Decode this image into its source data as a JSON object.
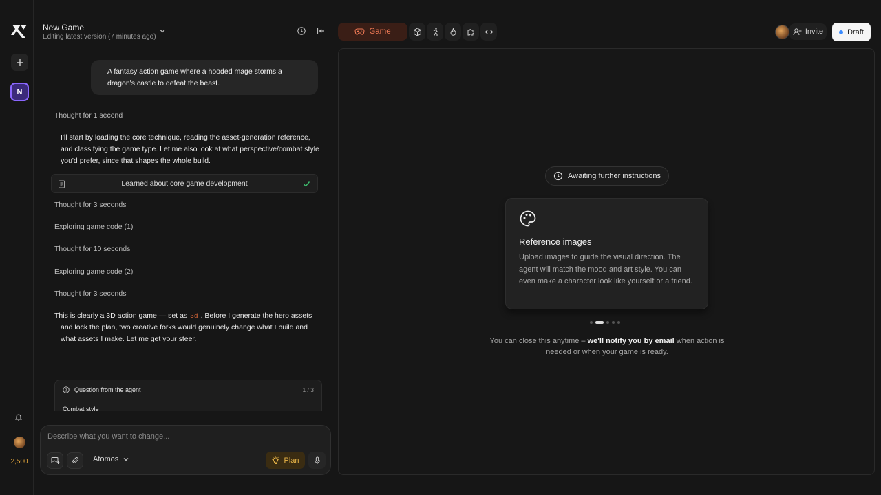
{
  "header": {
    "title": "New Game",
    "subtitle": "Editing latest version (7 minutes ago)"
  },
  "sidebar": {
    "project_initial": "N",
    "credits": "2,500"
  },
  "chat": {
    "user_message": "A fantasy action game where a hooded mage storms a dragon's castle to defeat the beast.",
    "thought_1": "Thought for 1 second",
    "para_1": "I'll start by loading the core technique, reading the asset-generation reference, and classifying the game type. Let me also look at what perspective/combat style you'd prefer, since that shapes the whole build.",
    "learned": "Learned about core game development",
    "thought_2": "Thought for 3 seconds",
    "explore_1": "Exploring game code (1)",
    "thought_3": "Thought for 10 seconds",
    "explore_2": "Exploring game code (2)",
    "thought_4": "Thought for 3 seconds",
    "para_2_pre": "This is clearly a 3D action game — set as",
    "para_2_code": "3d",
    "para_2_post": ". Before I generate the hero assets and lock the plan, two creative forks would genuinely change what I build and what assets I make. Let me get your steer.",
    "question": {
      "label": "Question from the agent",
      "count": "1 / 3",
      "topic": "Combat style"
    }
  },
  "composer": {
    "placeholder": "Describe what you want to change...",
    "model": "Atomos",
    "plan_label": "Plan"
  },
  "tabs": {
    "active_label": "Game",
    "icons": [
      "cube-icon",
      "figure-icon",
      "flame-icon",
      "puzzle-icon",
      "code-icon"
    ]
  },
  "topbar": {
    "invite_label": "Invite",
    "draft_label": "Draft"
  },
  "preview": {
    "status": "Awaiting further instructions",
    "card_title": "Reference images",
    "card_body": "Upload images to guide the visual direction. The agent will match the mood and art style. You can even make a character look like yourself or a friend.",
    "notice_pre": "You can close this anytime – ",
    "notice_bold": "we'll notify you by email",
    "notice_post": " when action is needed or when your game is ready.",
    "carousel_total": 5,
    "carousel_active": 2
  },
  "colors": {
    "background": "#161616",
    "accent_game": "#f07a56",
    "plan_gold": "#e8b447",
    "credits_gold": "#e2a53a",
    "project_purple": "#8b67ff",
    "check_green": "#3fbf6f",
    "draft_dot_blue": "#3b8bff"
  }
}
